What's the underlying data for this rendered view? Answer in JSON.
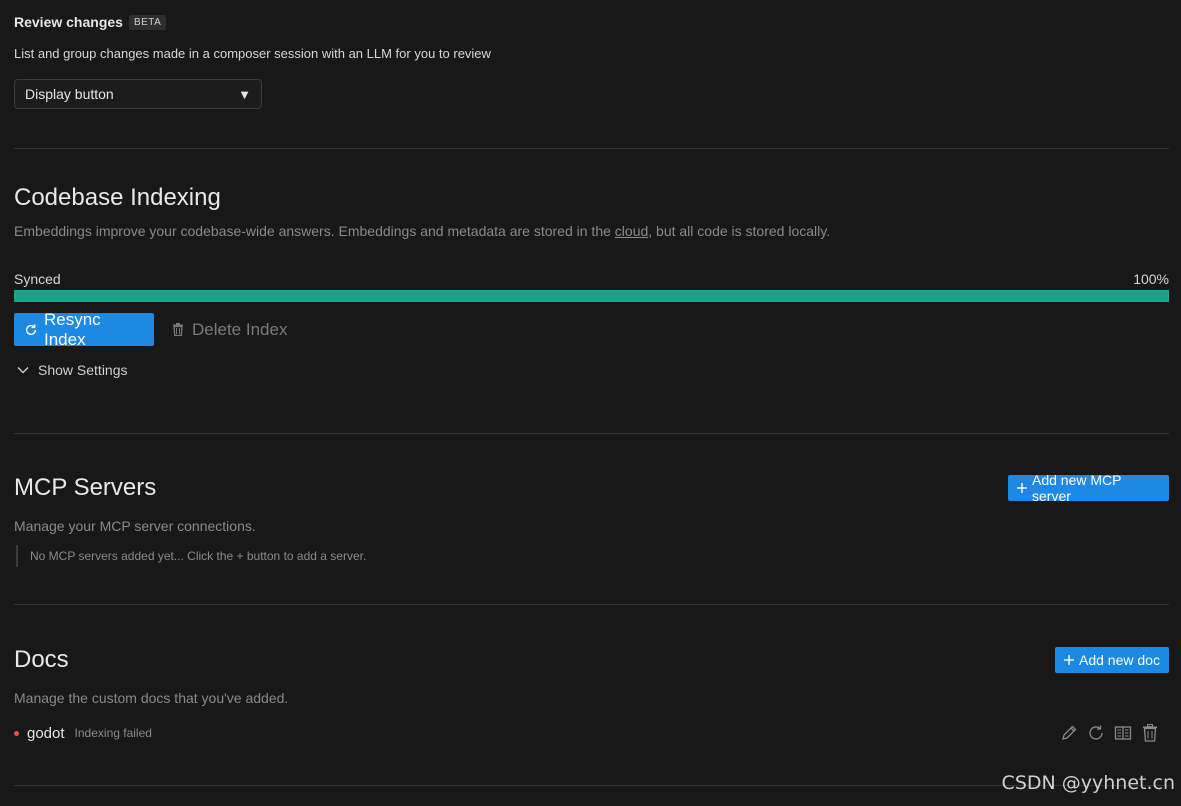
{
  "review": {
    "title": "Review changes",
    "badge": "BETA",
    "description": "List and group changes made in a composer session with an LLM for you to review",
    "select_value": "Display button",
    "select_caret": "▼"
  },
  "indexing": {
    "title": "Codebase Indexing",
    "desc_before": "Embeddings improve your codebase-wide answers. Embeddings and metadata are stored in the ",
    "desc_link": "cloud",
    "desc_after": ", but all code is stored locally.",
    "status": "Synced",
    "percent_label": "100%",
    "progress": 1.0,
    "resync_label": "Resync Index",
    "delete_label": "Delete Index",
    "show_settings_label": "Show Settings",
    "accent": "#1aa38a"
  },
  "mcp": {
    "title": "MCP Servers",
    "description": "Manage your MCP server connections.",
    "add_label": "Add new MCP server",
    "empty_message": "No MCP servers added yet... Click the + button to add a server."
  },
  "docs": {
    "title": "Docs",
    "description": "Manage the custom docs that you've added.",
    "add_label": "Add new doc",
    "items": [
      {
        "name": "godot",
        "status": "Indexing failed",
        "status_color": "#e5534b",
        "actions": [
          "edit-icon",
          "refresh-icon",
          "book-icon",
          "trash-icon"
        ]
      }
    ]
  },
  "watermark": "CSDN @yyhnet.cn",
  "colors": {
    "primary_button": "#1e88e5",
    "background": "#181818"
  }
}
